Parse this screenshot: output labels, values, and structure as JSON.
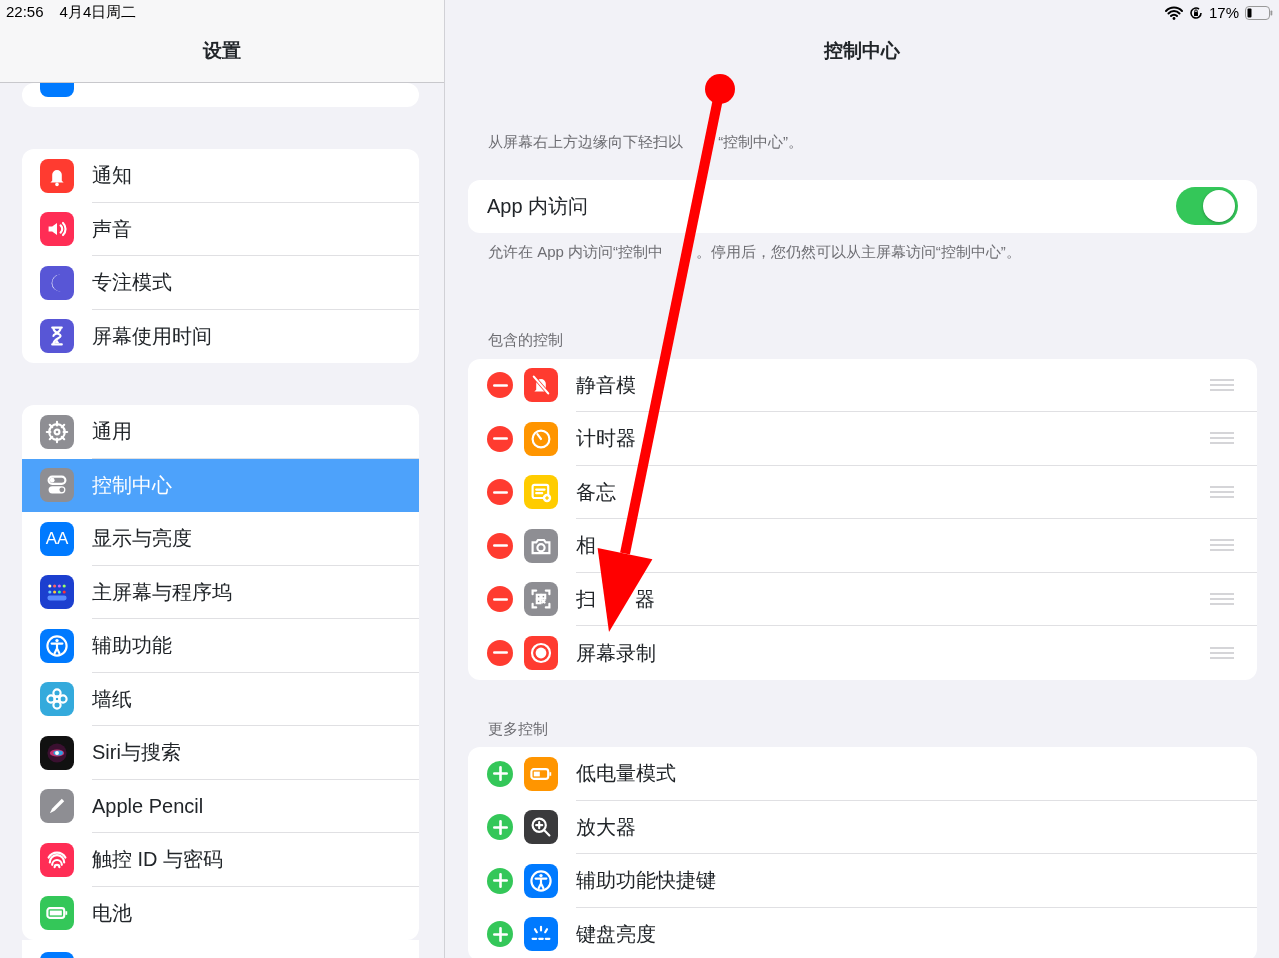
{
  "status_bar": {
    "time": "22:56",
    "date": "4月4日周二",
    "battery_percent": "17%"
  },
  "sidebar": {
    "title": "设置",
    "groups": [
      {
        "items": [
          {
            "label": "通知",
            "selected": false
          },
          {
            "label": "声音",
            "selected": false
          },
          {
            "label": "专注模式",
            "selected": false
          },
          {
            "label": "屏幕使用时间",
            "selected": false
          }
        ]
      },
      {
        "items": [
          {
            "label": "通用",
            "selected": false
          },
          {
            "label": "控制中心",
            "selected": true
          },
          {
            "label": "显示与亮度",
            "selected": false,
            "icon_text": "AA"
          },
          {
            "label": "主屏幕与程序坞",
            "selected": false
          },
          {
            "label": "辅助功能",
            "selected": false
          },
          {
            "label": "墙纸",
            "selected": false
          },
          {
            "label": "Siri与搜索",
            "selected": false
          },
          {
            "label": "Apple Pencil",
            "selected": false
          },
          {
            "label": "触控 ID 与密码",
            "selected": false
          },
          {
            "label": "电池",
            "selected": false
          }
        ]
      }
    ]
  },
  "detail": {
    "title": "控制中心",
    "hint": [
      "从屏幕右上方边缘向下轻扫以",
      "“控制中心”。"
    ],
    "access": {
      "label": "App 内访问",
      "on": true
    },
    "access_note": [
      "允许在 App 内访问“控制中",
      "。停用后，您仍然可以从主屏幕访问“控制中心”。"
    ],
    "sections": [
      {
        "header": "包含的控制",
        "kind": "remove",
        "items": [
          {
            "label": [
              "静音模"
            ]
          },
          {
            "label": "计时器"
          },
          {
            "label": [
              "备忘"
            ]
          },
          {
            "label": [
              "相"
            ]
          },
          {
            "label": [
              "扫",
              "器"
            ]
          },
          {
            "label": "屏幕录制"
          }
        ]
      },
      {
        "header": "更多控制",
        "kind": "add",
        "items": [
          {
            "label": "低电量模式"
          },
          {
            "label": "放大器"
          },
          {
            "label": "辅助功能快捷键"
          },
          {
            "label": "键盘亮度"
          }
        ]
      }
    ]
  }
}
